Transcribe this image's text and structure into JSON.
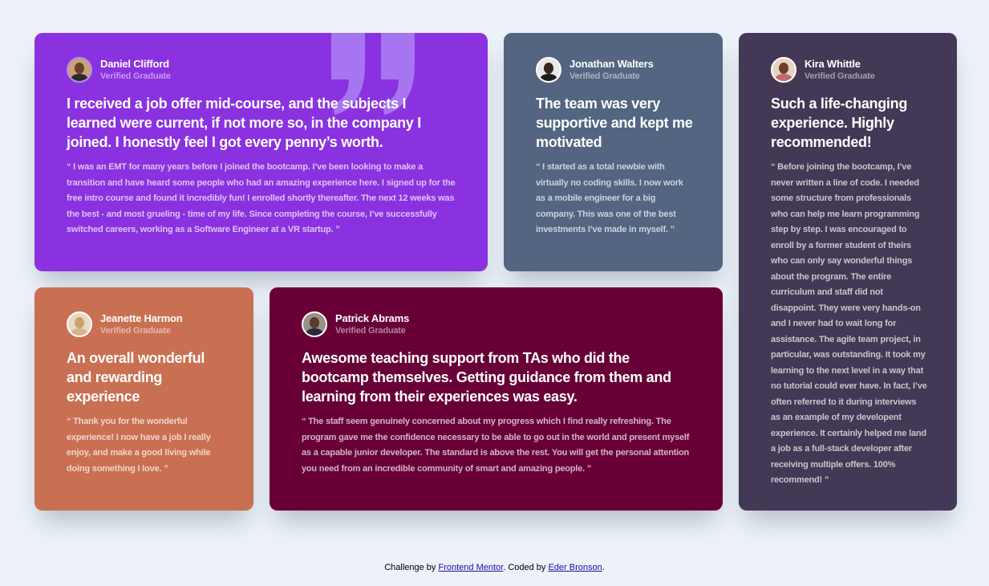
{
  "colors": {
    "page_background": "#ecf2f8",
    "violet": "#8a32e0",
    "grayish_blue": "#536580",
    "dark_blackish_blue": "#433855",
    "peach": "#ca7052",
    "dark_pink": "#680037",
    "quote_mark": "#a775f1"
  },
  "testimonials": [
    {
      "name": "Daniel Clifford",
      "role": "Verified Graduate",
      "headline": "I received a job offer mid-course, and the subjects I learned were current, if not more so, in the company I joined. I honestly feel I got every penny’s worth.",
      "quote": "“ I was an EMT for many years before I joined the bootcamp. I’ve been looking to make a transition and have heard some people who had an amazing experience here. I signed up for the free intro course and found it incredibly fun! I enrolled shortly thereafter. The next 12 weeks was the best - and most grueling - time of my life. Since completing the course, I’ve successfully switched careers, working as a Software Engineer at a VR startup. ”"
    },
    {
      "name": "Jonathan Walters",
      "role": "Verified Graduate",
      "headline": "The team was very supportive and kept me motivated",
      "quote": "“ I started as a total newbie with virtually no coding skills. I now work as a mobile engineer for a big company. This was one of the best investments I’ve made in myself. ”"
    },
    {
      "name": "Kira Whittle",
      "role": "Verified Graduate",
      "headline": "Such a life-changing experience. Highly recommended!",
      "quote": "“ Before joining the bootcamp, I’ve never written a line of code. I needed some structure from professionals who can help me learn programming step by step. I was encouraged to enroll by a former student of theirs who can only say wonderful things about the program. The entire curriculum and staff did not disappoint. They were very hands-on and I never had to wait long for assistance. The agile team project, in particular, was outstanding. It took my learning to the next level in a way that no tutorial could ever have. In fact, I’ve often referred to it during interviews as an example of my developent experience. It certainly helped me land a job as a full-stack developer after receiving multiple offers. 100% recommend! ”"
    },
    {
      "name": "Jeanette Harmon",
      "role": "Verified Graduate",
      "headline": "An overall wonderful and rewarding experience",
      "quote": "“ Thank you for the wonderful experience! I now have a job I really enjoy, and make a good living while doing something I love. ”"
    },
    {
      "name": "Patrick Abrams",
      "role": "Verified Graduate",
      "headline": "Awesome teaching support from TAs who did the bootcamp themselves. Getting guidance from them and learning from their experiences was easy.",
      "quote": "“ The staff seem genuinely concerned about my progress which I find really refreshing. The program gave me the confidence necessary to be able to go out in the world and present myself as a capable junior developer. The standard is above the rest. You will get the personal attention you need from an incredible community of smart and amazing people. ”"
    }
  ],
  "footer": {
    "prefix": "Challenge by ",
    "link1": "Frontend Mentor",
    "middle": ". Coded by ",
    "link2": "Eder Bronson",
    "suffix": "."
  }
}
